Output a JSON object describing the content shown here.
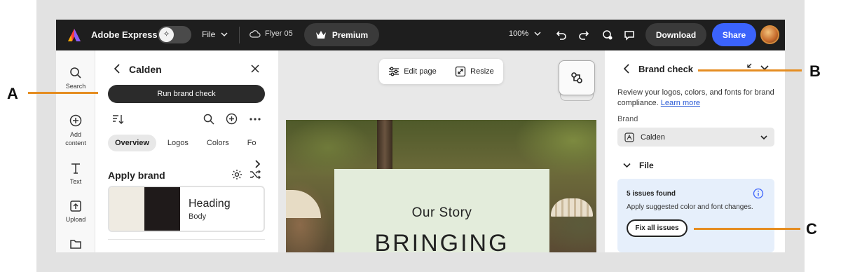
{
  "topbar": {
    "app_title": "Adobe Express",
    "file_label": "File",
    "doc_name": "Flyer 05",
    "premium_label": "Premium",
    "zoom_level": "100%",
    "download_label": "Download",
    "share_label": "Share"
  },
  "rail": {
    "items": [
      {
        "label": "Search",
        "icon": "search-icon"
      },
      {
        "label": "Add content",
        "icon": "plus-circle-icon"
      },
      {
        "label": "Text",
        "icon": "text-icon"
      },
      {
        "label": "Upload",
        "icon": "upload-icon"
      },
      {
        "label": "",
        "icon": "folder-icon"
      }
    ]
  },
  "left_panel": {
    "title": "Calden",
    "run_button": "Run brand check",
    "tabs": [
      {
        "label": "Overview",
        "active": true
      },
      {
        "label": "Logos",
        "active": false
      },
      {
        "label": "Colors",
        "active": false
      },
      {
        "label": "Fo",
        "active": false
      }
    ],
    "apply_title": "Apply brand",
    "card": {
      "heading": "Heading",
      "body": "Body",
      "swatches": [
        "#efebe2",
        "#1f1a1a"
      ]
    }
  },
  "canvas": {
    "edit_page": "Edit page",
    "resize": "Resize",
    "story_subtitle": "Our Story",
    "story_heading": "BRINGING"
  },
  "right_panel": {
    "title": "Brand check",
    "description": "Review your logos, colors, and fonts for brand compliance.",
    "learn_more": "Learn more",
    "brand_label": "Brand",
    "brand_value": "Calden",
    "file_section": "File",
    "issues_title": "5 issues found",
    "issues_desc": "Apply suggested color and font changes.",
    "fix_button": "Fix all issues"
  },
  "callouts": {
    "a": "A",
    "b": "B",
    "c": "C"
  },
  "colors": {
    "accent_blue": "#3b63fb",
    "callout_orange": "#e58d21",
    "topbar_bg": "#1e1e1e",
    "issues_bg": "#e6effb"
  }
}
